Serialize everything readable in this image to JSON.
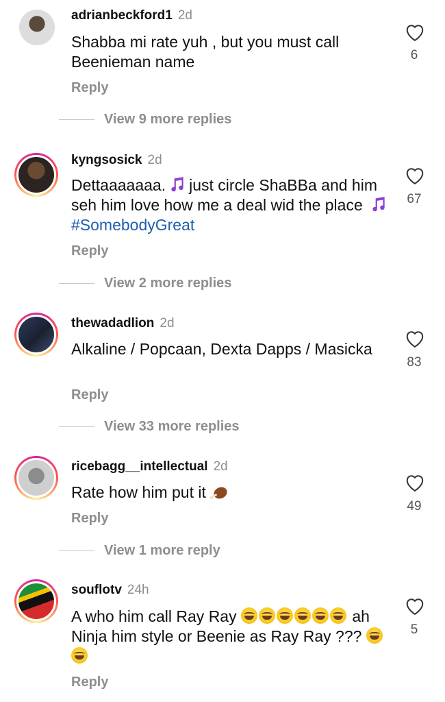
{
  "comments": [
    {
      "username": "adrianbeckford1",
      "time": "2d",
      "text": "Shabba mi rate yuh , but you must call Beenieman name",
      "likes": "6",
      "reply": "Reply",
      "view_more": "View 9 more replies",
      "avatar_icon": "avatar-icon"
    },
    {
      "username": "kyngsosick",
      "time": "2d",
      "text_part1": "Dettaaaaaaa.",
      "text_part2": "just circle ShaBBa and him seh him love how me a deal wid the place",
      "hashtag": "#SomebodyGreat",
      "likes": "67",
      "reply": "Reply",
      "view_more": "View 2 more replies",
      "avatar_icon": "avatar-icon"
    },
    {
      "username": "thewadadlion",
      "time": "2d",
      "text": "Alkaline / Popcaan, Dexta Dapps / Masicka",
      "likes": "83",
      "reply": "Reply",
      "view_more": "View 33 more replies",
      "avatar_icon": "avatar-icon"
    },
    {
      "username": "ricebagg__intellectual",
      "time": "2d",
      "text": "Rate how him put it",
      "likes": "49",
      "reply": "Reply",
      "view_more": "View 1 more reply",
      "avatar_icon": "avatar-icon"
    },
    {
      "username": "souflotv",
      "time": "24h",
      "text_line1": "A who him call Ray Ray",
      "text_line2": "ah Ninja him style or Beenie as Ray Ray ???",
      "likes": "5",
      "reply": "Reply",
      "avatar_icon": "avatar-icon"
    }
  ],
  "icons": {
    "like": "heart-outline-icon",
    "music": "music-note-icon",
    "laugh": "tears-of-joy-emoji",
    "chicken": "poultry-leg-emoji"
  },
  "colors": {
    "text": "#111111",
    "secondary": "#8e8e8e",
    "hashtag": "#1f5fae",
    "music_note": "#8e3fd6"
  }
}
